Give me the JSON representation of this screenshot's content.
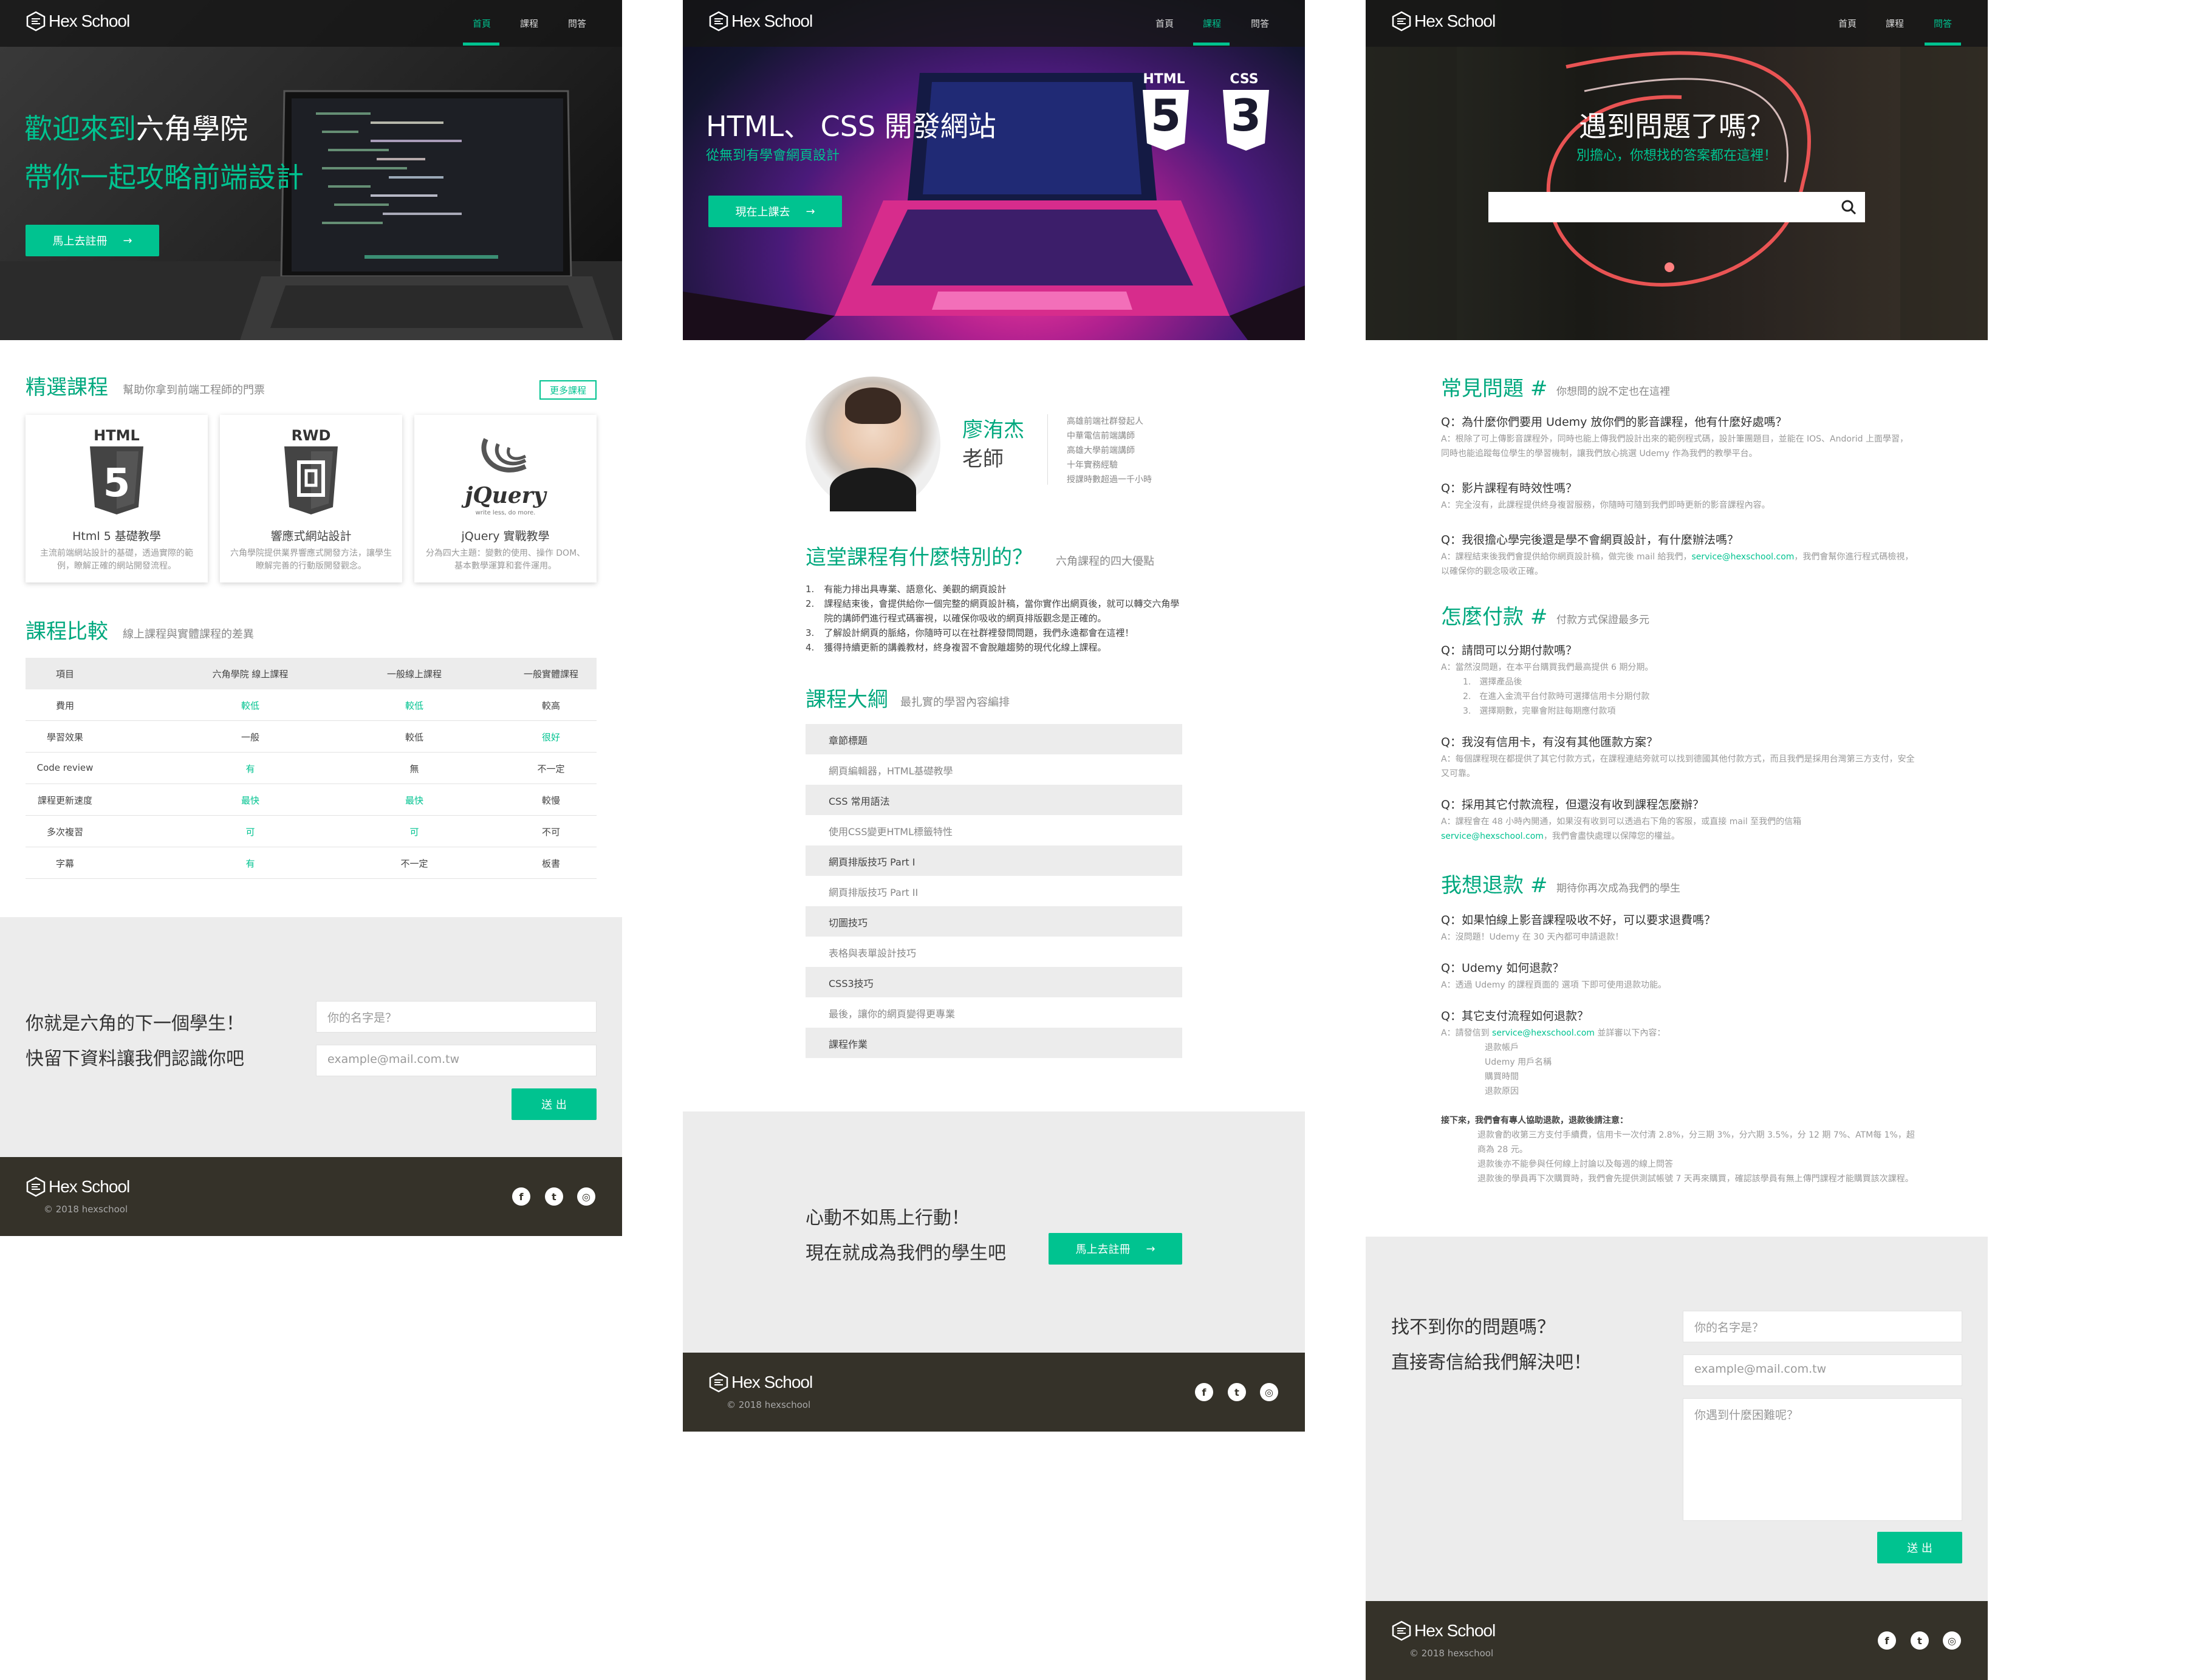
{
  "brand": {
    "name": "Hex School",
    "copyright": "© 2018 hexschool"
  },
  "nav": {
    "home": "首頁",
    "courses": "課程",
    "faq": "問答"
  },
  "accent": "#00c390",
  "page1": {
    "hero_line1_a": "歡迎來到",
    "hero_line1_b": "六角學院",
    "hero_line2": "帶你一起攻略前端設計",
    "hero_button": "馬上去註冊",
    "featured_title": "精選課程",
    "featured_sub": "幫助你拿到前端工程師的門票",
    "more_button": "更多課程",
    "courses": [
      {
        "badge": "HTML",
        "icon": "html5-icon",
        "title": "Html 5 基礎教學",
        "desc": "主流前端網站設計的基礎，透過實際的範例，瞭解正確的網站開發流程。"
      },
      {
        "badge": "RWD",
        "icon": "rwd-icon",
        "title": "響應式網站設計",
        "desc": "六角學院提供業界響應式開發方法，讓學生瞭解完善的行動版開發觀念。"
      },
      {
        "badge": "jQuery",
        "icon": "jquery-icon",
        "title": "jQuery 實戰教學",
        "desc": "分為四大主題：變數的使用、操作 DOM、基本數學運算和套件運用。",
        "tagline": "write less, do more."
      }
    ],
    "compare_title": "課程比較",
    "compare_sub": "線上課程與實體課程的差異",
    "compare_headers": [
      "項目",
      "六角學院 線上課程",
      "一般線上課程",
      "一般實體課程"
    ],
    "compare_rows": [
      [
        "費用",
        "較低",
        "較低",
        "較高"
      ],
      [
        "學習效果",
        "一般",
        "較低",
        "很好"
      ],
      [
        "Code review",
        "有",
        "無",
        "不一定"
      ],
      [
        "課程更新速度",
        "最快",
        "最快",
        "較慢"
      ],
      [
        "多次複習",
        "可",
        "可",
        "不可"
      ],
      [
        "字幕",
        "有",
        "不一定",
        "板書"
      ]
    ],
    "signup_line1": "你就是六角的下一個學生！",
    "signup_line2": "快留下資料讓我們認識你吧",
    "name_placeholder": "你的名字是？",
    "email_placeholder": "example@mail.com.tw",
    "submit": "送 出"
  },
  "page2": {
    "hero_title": "HTML、 CSS 開發網站",
    "hero_sub": "從無到有學會網頁設計",
    "hero_button": "現在上課去",
    "badge_html": "HTML",
    "badge_css": "CSS",
    "html_num": "5",
    "css_num": "3",
    "teacher_name": "廖洧杰",
    "teacher_title": "老師",
    "teacher_facts": [
      "高雄前端社群發起人",
      "中華電信前端講師",
      "高雄大學前端講師",
      "十年實務經驗",
      "授課時數超過一千小時"
    ],
    "special_title": "這堂課程有什麼特別的？",
    "special_sub": "六角課程的四大優點",
    "advantages": [
      "有能力排出具專業、語意化、美觀的網頁設計",
      "課程結束後，會提供給你一個完整的網頁設計稿，當你實作出網頁後，就可以轉交六角學院的講師們進行程式碼審視，以確保你吸收的網頁排版觀念是正確的。",
      "了解設計網頁的脈絡，你隨時可以在社群裡發問問題，我們永遠都會在這裡！",
      "獲得持續更新的講義教材，終身複習不會脫離趨勢的現代化線上課程。"
    ],
    "outline_title": "課程大綱",
    "outline_sub": "最扎實的學習內容編排",
    "outline": [
      "章節標題",
      "網頁編輯器，HTML基礎教學",
      "CSS 常用語法",
      "使用CSS變更HTML標籤特性",
      "網頁排版技巧 Part I",
      "網頁排版技巧 Part II",
      "切圖技巧",
      "表格與表單設計技巧",
      "CSS3技巧",
      "最後，讓你的網頁變得更專業",
      "課程作業"
    ],
    "cta_line1": "心動不如馬上行動！",
    "cta_line2": "現在就成為我們的學生吧",
    "cta_button": "馬上去註冊"
  },
  "page3": {
    "hero_title": "遇到問題了嗎？",
    "hero_sub": "別擔心，你想找的答案都在這裡！",
    "s1_title": "常見問題",
    "s1_sub": "你想問的說不定也在這裡",
    "s1_qa": [
      {
        "q": "Q：為什麼你們要用 Udemy 放你們的影音課程，他有什麼好處嗎？",
        "a": "A：根除了可上傳影音課程外，同時也能上傳我們設計出來的範例程式碼，設計筆團題目，並能在 IOS、Andorid 上面學習，同時也能追蹤每位學生的學習機制，讓我們放心挑選 Udemy 作為我們的教學平台。"
      },
      {
        "q": "Q：影片課程有時效性嗎？",
        "a": "A：完全沒有，此課程提供終身複習服務，你隨時可隨到我們即時更新的影音課程內容。"
      },
      {
        "q": "Q：我很擔心學完後還是學不會網頁設計，有什麼辦法嗎？",
        "a_pre": "A：課程結束後我們會提供給你網頁設計稿，做完後 mail 給我們，",
        "email": "service@hexschool.com",
        "a_post": "，我們會幫你進行程式碼檢視，以確保你的觀念吸收正確。"
      }
    ],
    "s2_title": "怎麼付款",
    "s2_sub": "付款方式保證最多元",
    "s2_q1": "Q：請問可以分期付款嗎？",
    "s2_a1": "A：當然沒問題，在本平台購買我們最高提供 6 期分期。",
    "s2_steps": [
      "1.　選擇產品後",
      "2.　在進入金流平台付款時可選擇信用卡分期付款",
      "3.　選擇期數，完畢會附註每期應付款項"
    ],
    "s2_q2": "Q：我沒有信用卡，有沒有其他匯款方案？",
    "s2_a2": "A：每個課程現在都提供了其它付款方式，在課程連結旁就可以找到德國其他付款方式，而且我們是採用台灣第三方支付，安全又可靠。",
    "s2_q3": "Q：採用其它付款流程，但還沒有收到課程怎麼辦？",
    "s2_a3_pre": "A：課程會在 48 小時內開通，如果沒有收到可以透過右下角的客服，或直接 mail 至我們的信箱",
    "s2_a3_email": "service@hexschool.com",
    "s2_a3_post": "，我們會盡快處理以保障您的權益。",
    "s3_title": "我想退款",
    "s3_sub": "期待你再次成為我們的學生",
    "s3_q1": "Q：如果怕線上影音課程吸收不好，可以要求退費嗎？",
    "s3_a1": "A：沒問題！Udemy 在 30 天內都可申請退款！",
    "s3_q2": "Q：Udemy 如何退款？",
    "s3_a2": "A：透過 Udemy 的課程頁面的 選項 下即可使用退款功能。",
    "s3_q3": "Q：其它支付流程如何退款？",
    "s3_a3_pre": "A：請發信到 ",
    "s3_a3_email": "service@hexschool.com",
    "s3_a3_post": " 並詳審以下內容：",
    "s3_items": [
      "退款帳戶",
      "Udemy 用戶名稱",
      "購買時間",
      "退款原因"
    ],
    "notice_head": "接下來，我們會有專人協助退款，退款後請注意：",
    "notice_1": "退款會酌收第三方支付手續費，信用卡一次付清 2.8%，分三期 3%，分六期 3.5%，分 12 期 7%、ATM每 1%，超商為 28 元。",
    "notice_2": "退款後亦不能參與任何線上討論以及每週的線上問答",
    "notice_3": "退款後的學員再下次購買時，我們會先提供測試帳號 7 天再來購買，確認該學員有無上傳門課程才能購買該次課程。",
    "contact_line1": "找不到你的問題嗎？",
    "contact_line2": "直接寄信給我們解決吧！",
    "name_placeholder": "你的名字是？",
    "email_placeholder": "example@mail.com.tw",
    "message_placeholder": "你遇到什麼困難呢？",
    "submit": "送 出"
  }
}
